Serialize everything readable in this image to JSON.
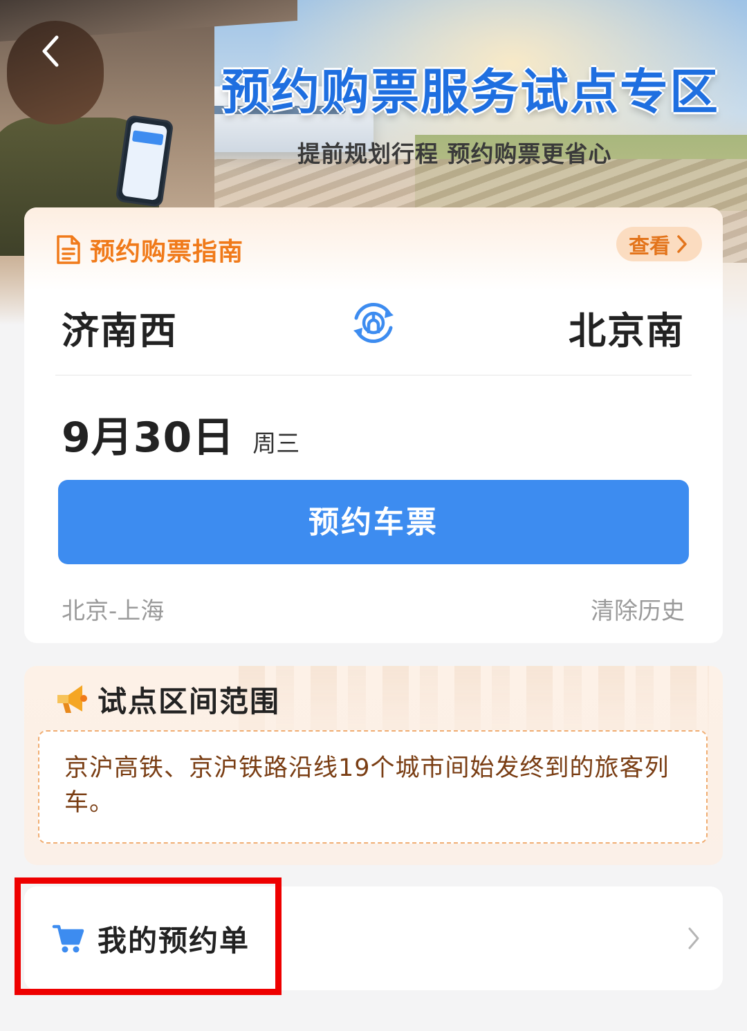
{
  "hero": {
    "title": "预约购票服务试点专区",
    "subtitle": "提前规划行程 预约购票更省心",
    "back_icon": "chevron-left-icon"
  },
  "guide": {
    "label": "预约购票指南",
    "icon": "document-icon",
    "view_label": "查看",
    "view_icon": "chevron-right-icon"
  },
  "trip": {
    "from_station": "济南西",
    "to_station": "北京南",
    "swap_icon": "railway-swap-icon",
    "date": "9月30日",
    "weekday": "周三"
  },
  "book_button": "预约车票",
  "history": {
    "item": "北京-上海",
    "clear_label": "清除历史"
  },
  "pilot_range": {
    "title": "试点区间范围",
    "icon": "megaphone-icon",
    "description": "京沪高铁、京沪铁路沿线19个城市间始发终到的旅客列车。"
  },
  "my_orders": {
    "label": "我的预约单",
    "icon": "cart-icon",
    "arrow_icon": "chevron-right-icon"
  },
  "colors": {
    "primary_blue": "#3d8cf0",
    "accent_orange": "#f07a1a",
    "highlight_red": "#ee0000"
  }
}
